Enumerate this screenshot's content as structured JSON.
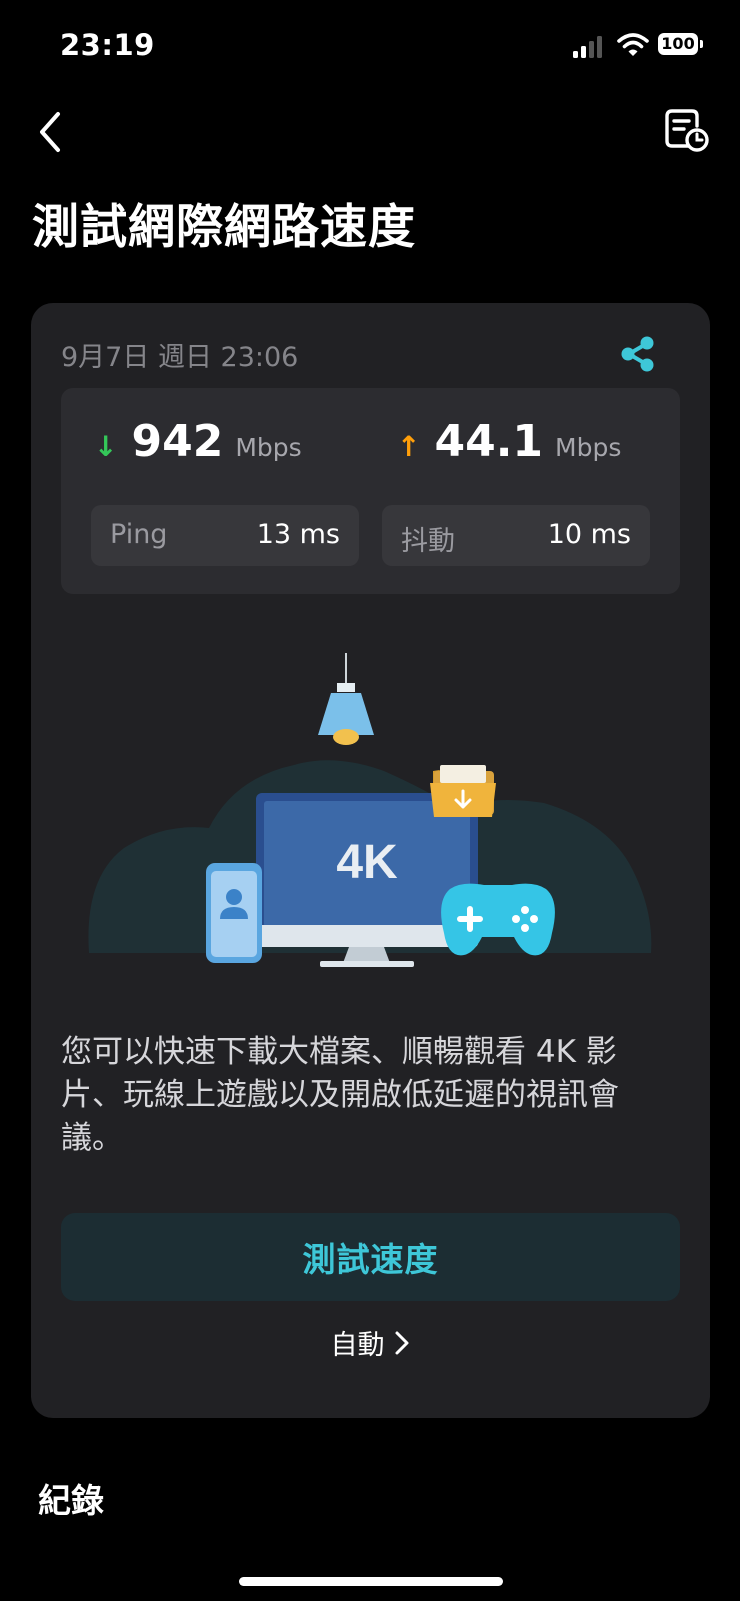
{
  "status_bar": {
    "time": "23:19",
    "battery": "100"
  },
  "header": {
    "title": "測試網際網路速度"
  },
  "result_card": {
    "date": "9月7日 週日 23:06",
    "download": {
      "value": "942",
      "unit": "Mbps",
      "color": "#34c759"
    },
    "upload": {
      "value": "44.1",
      "unit": "Mbps",
      "color": "#ff9f0a"
    },
    "ping": {
      "label": "Ping",
      "value": "13 ms"
    },
    "jitter": {
      "label": "抖動",
      "value": "10 ms"
    },
    "illustration": {
      "screen_text": "4K"
    },
    "description": "您可以快速下載大檔案、順暢觀看 4K 影片、玩線上遊戲以及開啟低延遲的視訊會議。",
    "test_button": "測試速度",
    "auto_link": "自動"
  },
  "history": {
    "heading": "紀錄"
  },
  "colors": {
    "accent": "#3ec7d8",
    "background": "#000000",
    "card": "#212124"
  }
}
